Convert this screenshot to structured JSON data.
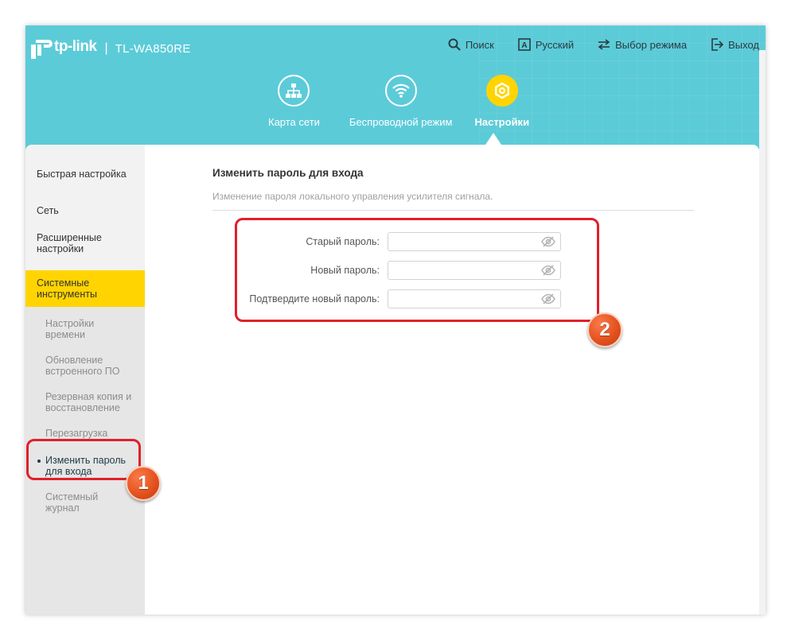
{
  "brand": {
    "logo_text": "tp-link",
    "separator": "|",
    "model": "TL-WA850RE"
  },
  "top_nav": {
    "search": "Поиск",
    "language": "Русский",
    "mode": "Выбор режима",
    "logout": "Выход",
    "language_icon_letter": "A"
  },
  "main_nav": [
    {
      "label": "Карта сети",
      "icon": "network-map-icon"
    },
    {
      "label": "Беспроводной режим",
      "icon": "wifi-icon"
    },
    {
      "label": "Настройки",
      "icon": "settings-gear-icon",
      "active": true
    }
  ],
  "sidebar": {
    "items": [
      "Быстрая настройка",
      "Сеть",
      "Расширенные настройки",
      "Системные инструменты"
    ],
    "active_item": "Системные инструменты",
    "sub_items": [
      "Настройки времени",
      "Обновление встроенного ПО",
      "Резервная копия и восстановление",
      "Перезагрузка",
      "Изменить пароль для входа",
      "Системный журнал"
    ],
    "current_sub_item": "Изменить пароль для входа"
  },
  "panel": {
    "title": "Изменить пароль для входа",
    "description": "Изменение пароля локального управления усилителя сигнала.",
    "fields": [
      {
        "label": "Старый пароль:",
        "value": ""
      },
      {
        "label": "Новый пароль:",
        "value": ""
      },
      {
        "label": "Подтвердите новый пароль:",
        "value": ""
      }
    ]
  },
  "annotations": {
    "badge_1": "1",
    "badge_2": "2"
  },
  "colors": {
    "header": "#5ccbd8",
    "accent_yellow": "#ffd400",
    "highlight_red": "#e1202a",
    "badge_orange": "#e4531f"
  }
}
